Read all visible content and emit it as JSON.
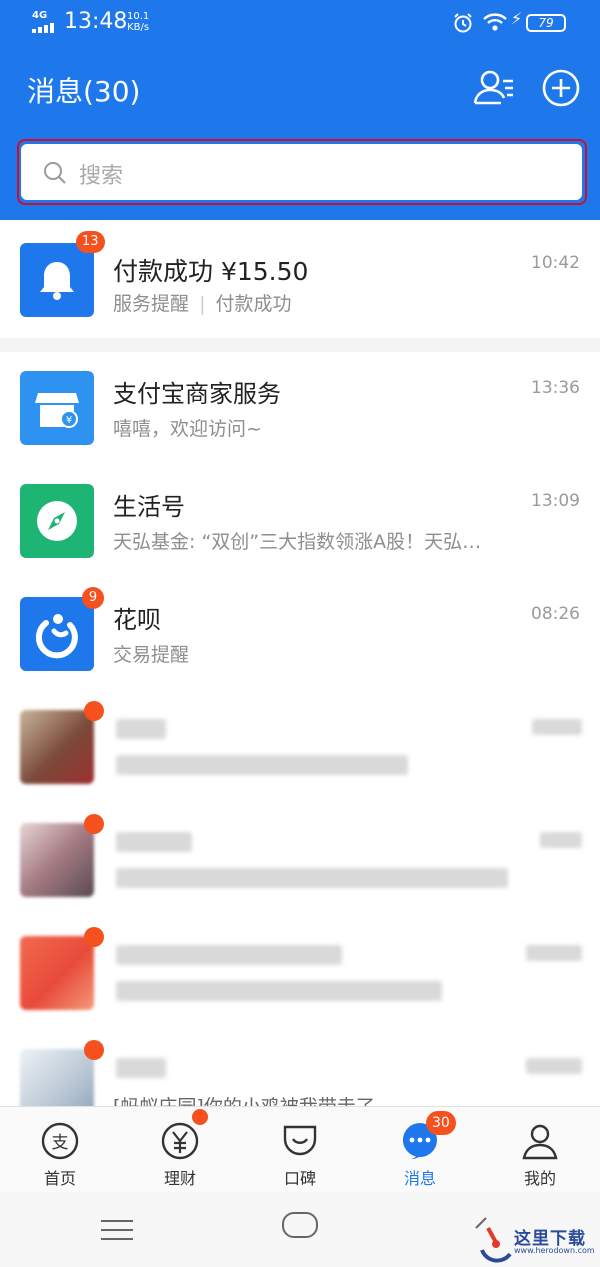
{
  "status_bar": {
    "network": "4G",
    "time": "13:48",
    "speed_value": "10.1",
    "speed_unit": "KB/s",
    "battery": "79"
  },
  "header": {
    "title": "消息(30)",
    "search_placeholder": "搜索",
    "accent": "#1e78ec"
  },
  "messages": [
    {
      "title": "付款成功 ¥15.50",
      "subtitle_part1": "服务提醒",
      "subtitle_part2": "付款成功",
      "time": "10:42",
      "badge": "13",
      "icon": "bell-icon",
      "color": "#1e78ec"
    },
    {
      "title": "支付宝商家服务",
      "subtitle": "嘻嘻，欢迎访问~",
      "time": "13:36",
      "icon": "shop-icon",
      "color": "#2d92f0"
    },
    {
      "title": "生活号",
      "subtitle": "天弘基金: “双创”三大指数领涨A股！天弘…",
      "time": "13:09",
      "icon": "compass-icon",
      "color": "#1eb574"
    },
    {
      "title": "花呗",
      "subtitle": "交易提醒",
      "time": "08:26",
      "badge": "9",
      "icon": "huabei-icon",
      "color": "#1e78ec"
    }
  ],
  "partial_message": {
    "subtitle": "[蚂蚁庄园]你的小鸡被我带走了"
  },
  "tabs": [
    {
      "label": "首页",
      "icon": "alipay-icon"
    },
    {
      "label": "理财",
      "icon": "yen-icon"
    },
    {
      "label": "口碑",
      "icon": "koubei-icon"
    },
    {
      "label": "消息",
      "icon": "chat-icon",
      "badge": "30"
    },
    {
      "label": "我的",
      "icon": "user-icon"
    }
  ],
  "watermark": {
    "text": "这里下载",
    "url": "www.herodown.com"
  }
}
